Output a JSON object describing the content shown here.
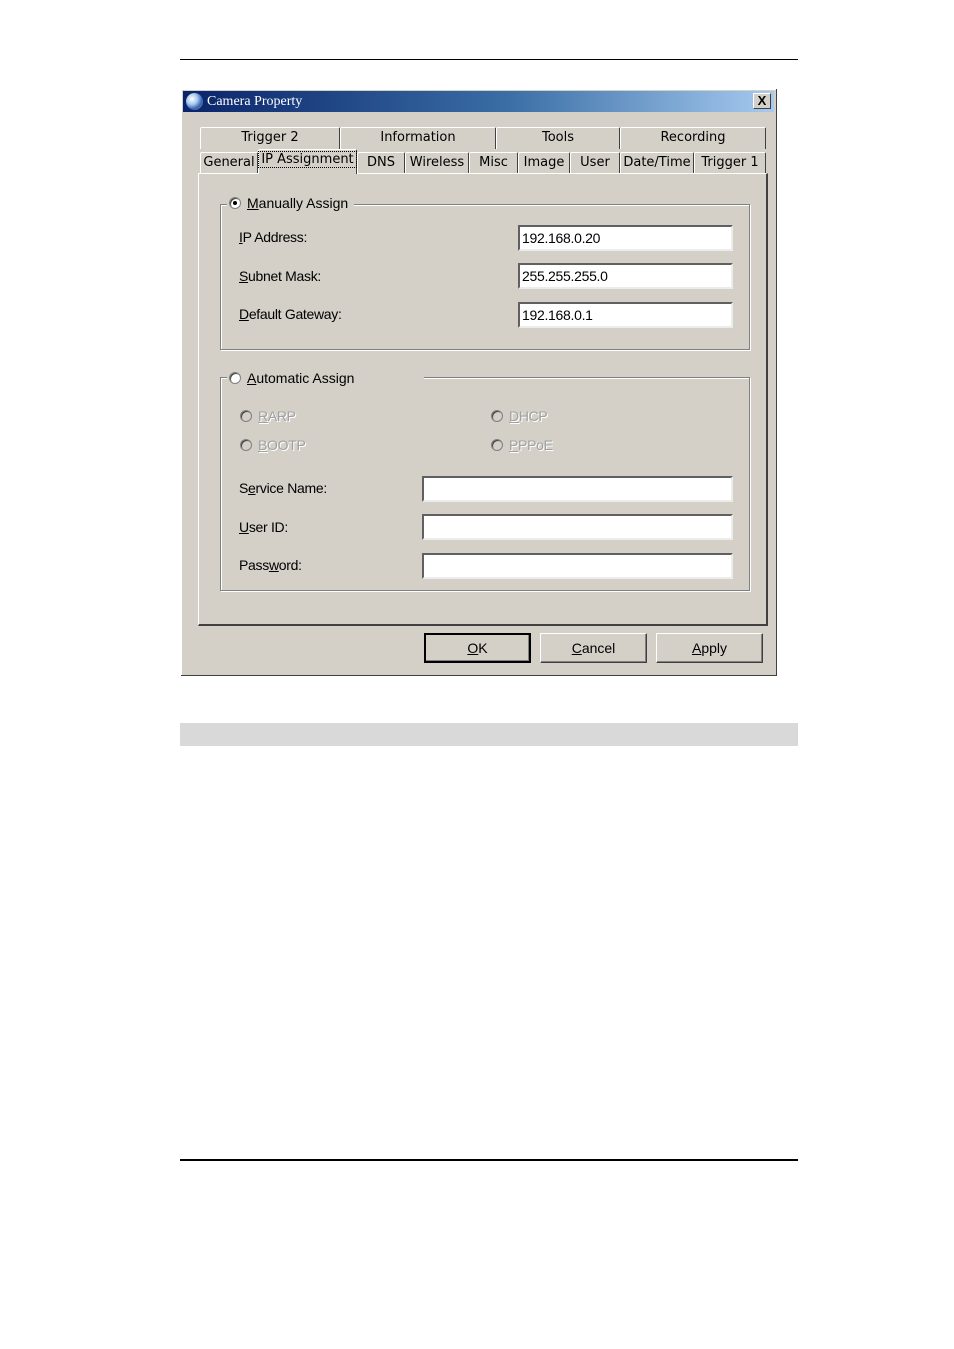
{
  "window": {
    "title": "Camera Property",
    "close_label": "X"
  },
  "tabs_row_back": [
    {
      "label": "Trigger 2"
    },
    {
      "label": "Information"
    },
    {
      "label": "Tools"
    },
    {
      "label": "Recording"
    }
  ],
  "tabs_row_front": [
    {
      "label": "General"
    },
    {
      "label": "IP Assignment",
      "active": true
    },
    {
      "label": "DNS"
    },
    {
      "label": "Wireless"
    },
    {
      "label": "Misc"
    },
    {
      "label": "Image"
    },
    {
      "label": "User"
    },
    {
      "label": "Date/Time"
    },
    {
      "label": "Trigger 1"
    }
  ],
  "manual": {
    "label_accel": "M",
    "label_rest": "anually Assign",
    "selected": true,
    "fields": [
      {
        "label_accel": "I",
        "label_rest": "P Address:",
        "value": "192.168.0.20"
      },
      {
        "label_accel": "S",
        "label_rest": "ubnet Mask:",
        "value": "255.255.255.0"
      },
      {
        "label_accel": "D",
        "label_rest": "efault Gateway:",
        "value": "192.168.0.1"
      }
    ]
  },
  "automatic": {
    "label_accel": "A",
    "label_rest": "utomatic Assign",
    "selected": false,
    "options": [
      {
        "accel": "R",
        "rest": "ARP",
        "enabled": false
      },
      {
        "accel": "D",
        "rest": "HCP",
        "enabled": false
      },
      {
        "accel": "B",
        "rest": "OOTP",
        "enabled": false
      },
      {
        "accel": "P",
        "rest": "PPoE",
        "enabled": false
      }
    ],
    "fields": [
      {
        "label_pre": "S",
        "label_accel": "e",
        "label_rest": "rvice Name:",
        "value": ""
      },
      {
        "label_pre": "",
        "label_accel": "U",
        "label_rest": "ser ID:",
        "value": ""
      },
      {
        "label_pre": "Pass",
        "label_accel": "w",
        "label_rest": "ord:",
        "value": ""
      }
    ]
  },
  "buttons": {
    "ok": {
      "accel": "O",
      "rest": "K"
    },
    "cancel": {
      "accel": "C",
      "rest": "ancel"
    },
    "apply": {
      "accel": "A",
      "rest": "pply"
    }
  }
}
